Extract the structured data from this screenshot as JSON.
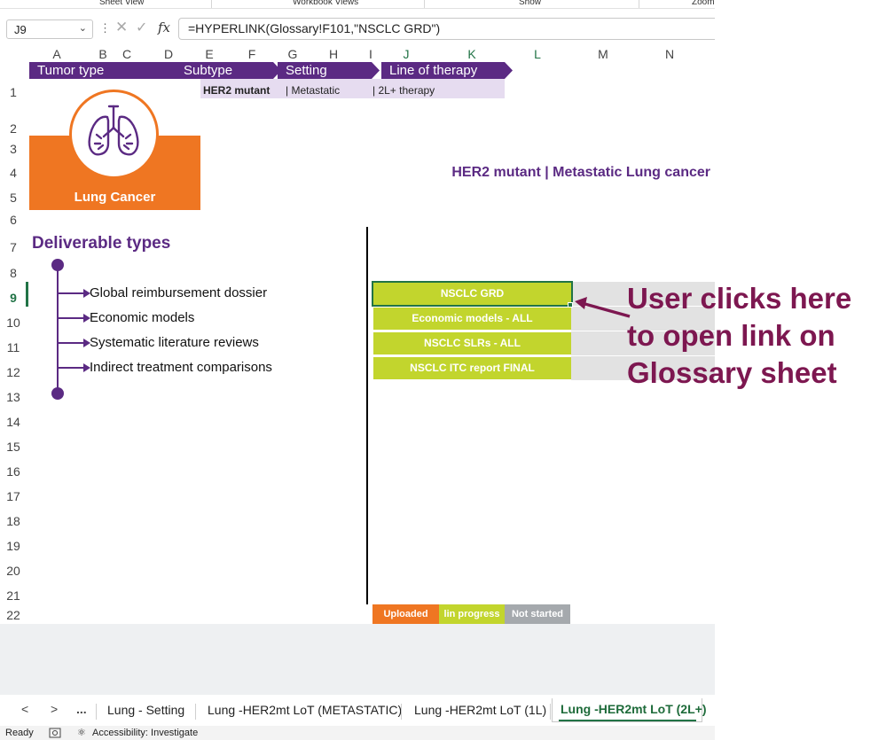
{
  "ribbon": {
    "labels": [
      "Sheet View",
      "Workbook Views",
      "Show",
      "Zoom"
    ]
  },
  "formula_bar": {
    "name_box": "J9",
    "formula": "=HYPERLINK(Glossary!F101,\"NSCLC GRD\")",
    "fx": "fx"
  },
  "grid": {
    "columns": [
      "A",
      "B",
      "C",
      "D",
      "E",
      "F",
      "G",
      "H",
      "I",
      "J",
      "K",
      "L",
      "M",
      "N"
    ],
    "rows": [
      "1",
      "2",
      "3",
      "4",
      "5",
      "6",
      "7",
      "8",
      "9",
      "10",
      "11",
      "12",
      "13",
      "14",
      "15",
      "16",
      "17",
      "18",
      "19",
      "20",
      "21",
      "22"
    ],
    "active_cell": "J9"
  },
  "breadcrumb": {
    "segments": [
      "Tumor type",
      "Subtype",
      "Setting",
      "Line of therapy"
    ],
    "values": {
      "subtype": "HER2 mutant",
      "setting": "| Metastatic",
      "line": "| 2L+ therapy"
    }
  },
  "logo": {
    "label": "Lung Cancer",
    "icon": "lungs-icon",
    "color": "#ef7622"
  },
  "title": "HER2 mutant | Metastatic Lung cancer",
  "deliverables": {
    "heading": "Deliverable types",
    "items": [
      "Global reimbursement dossier",
      "Economic models",
      "Systematic literature reviews",
      "Indirect treatment comparisons"
    ]
  },
  "status_buttons": [
    {
      "label": "NSCLC GRD",
      "selected": true
    },
    {
      "label": "Economic models - ALL"
    },
    {
      "label": "NSCLC SLRs - ALL"
    },
    {
      "label": "NSCLC ITC report FINAL"
    }
  ],
  "legend": [
    {
      "label": "Uploaded",
      "color": "#ef7622"
    },
    {
      "label": "lin progress",
      "color": "#c2d52d"
    },
    {
      "label": "Not started",
      "color": "#a5a9ad"
    }
  ],
  "sheet_tabs": {
    "nav": [
      "<",
      ">",
      "..."
    ],
    "tabs": [
      "Lung - Setting",
      "Lung -HER2mt LoT (METASTATIC)",
      "Lung -HER2mt LoT (1L)"
    ],
    "active": "Lung -HER2mt LoT (2L+)"
  },
  "status_bar": {
    "ready": "Ready",
    "accessibility": "Accessibility: Investigate"
  },
  "annotation": {
    "text": "User clicks here to open link on Glossary sheet",
    "color": "#7d1750"
  },
  "colors": {
    "purple": "#5b2a83",
    "green_btn": "#c2d52d",
    "excel_green": "#217346"
  }
}
